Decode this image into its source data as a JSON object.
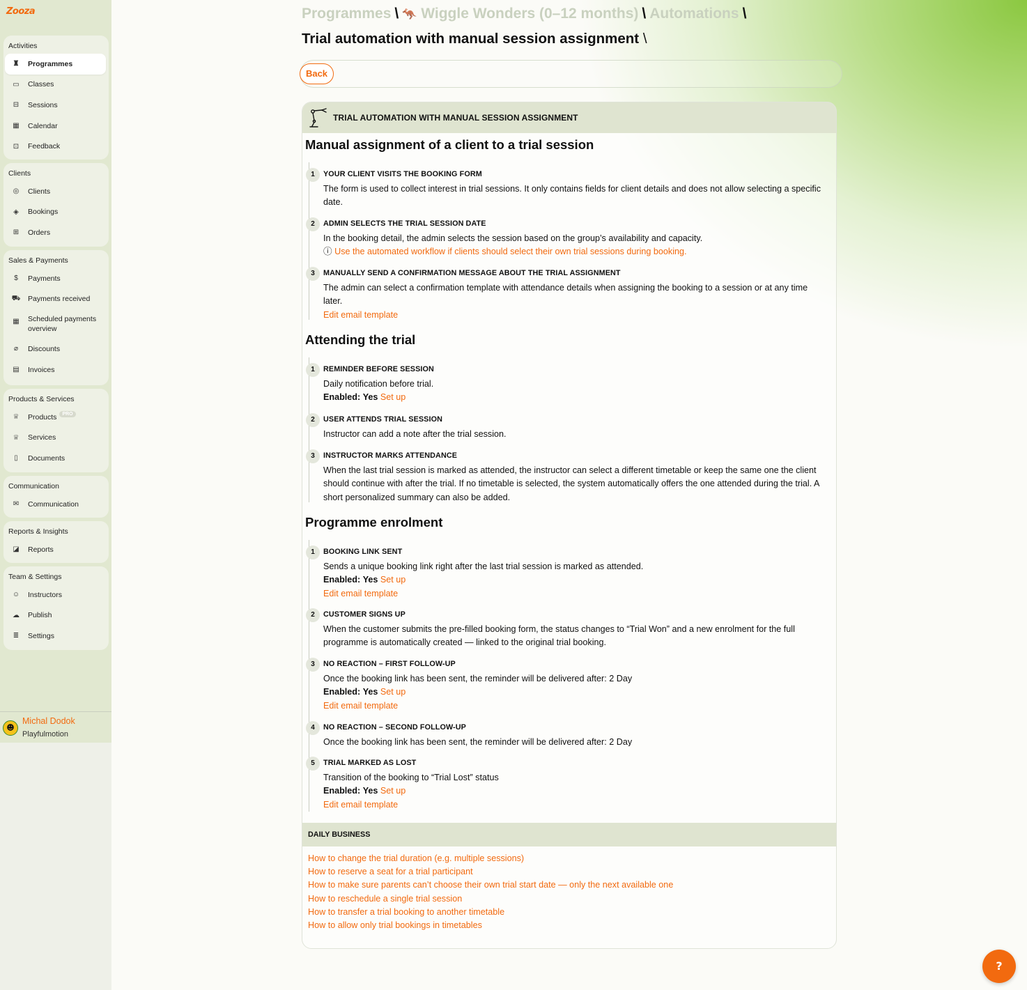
{
  "app": {
    "logo_text": "Zooza"
  },
  "sidebar": {
    "groups": [
      {
        "title": "Activities",
        "items": [
          {
            "label": "Programmes",
            "icon": "trophy-icon"
          },
          {
            "label": "Classes",
            "icon": "folder-icon"
          },
          {
            "label": "Sessions",
            "icon": "briefcase-icon"
          },
          {
            "label": "Calendar",
            "icon": "calendar-icon"
          },
          {
            "label": "Feedback",
            "icon": "inbox-icon"
          }
        ]
      },
      {
        "title": "Clients",
        "items": [
          {
            "label": "Clients",
            "icon": "users-icon"
          },
          {
            "label": "Bookings",
            "icon": "layers-icon"
          },
          {
            "label": "Orders",
            "icon": "gift-icon"
          }
        ]
      },
      {
        "title": "Sales & Payments",
        "items": [
          {
            "label": "Payments",
            "icon": "dollar-icon"
          },
          {
            "label": "Payments received",
            "icon": "cart-icon"
          },
          {
            "label": "Scheduled payments overview",
            "icon": "calendar-grid-icon"
          },
          {
            "label": "Discounts",
            "icon": "tag-icon"
          },
          {
            "label": "Invoices",
            "icon": "receipt-icon"
          }
        ]
      },
      {
        "title": "Products & Services",
        "items": [
          {
            "label": "Products",
            "icon": "crown-icon",
            "badge": "PRO"
          },
          {
            "label": "Services",
            "icon": "crown-icon"
          },
          {
            "label": "Documents",
            "icon": "document-icon"
          }
        ]
      },
      {
        "title": "Communication",
        "items": [
          {
            "label": "Communication",
            "icon": "mail-icon"
          }
        ]
      },
      {
        "title": "Reports & Insights",
        "items": [
          {
            "label": "Reports",
            "icon": "chart-icon"
          }
        ]
      },
      {
        "title": "Team & Settings",
        "items": [
          {
            "label": "Instructors",
            "icon": "user-icon"
          },
          {
            "label": "Publish",
            "icon": "cloud-upload-icon"
          },
          {
            "label": "Settings",
            "icon": "sliders-icon"
          }
        ]
      }
    ],
    "user": {
      "name": "Michal Dodok",
      "org": "Playfulmotion"
    }
  },
  "breadcrumb": {
    "items": [
      "Programmes",
      "Wiggle Wonders (0–12 months)",
      "Automations"
    ],
    "separator": "\\"
  },
  "page": {
    "title": "Trial automation with manual session assignment",
    "title_suffix": "\\",
    "back_label": "Back"
  },
  "card": {
    "header": "TRIAL AUTOMATION WITH MANUAL SESSION ASSIGNMENT",
    "sections": [
      {
        "title": "Manual assignment of a client to a trial session",
        "steps": [
          {
            "num": "1",
            "title": "YOUR CLIENT VISITS THE BOOKING FORM",
            "text": "The form is used to collect interest in trial sessions. It only contains fields for client details and does not allow selecting a specific date."
          },
          {
            "num": "2",
            "title": "ADMIN SELECTS THE TRIAL SESSION DATE",
            "text": "In the booking detail, the admin selects the session based on the group’s availability and capacity.",
            "info_link": "Use the automated workflow if clients should select their own trial sessions during booking."
          },
          {
            "num": "3",
            "title": "MANUALLY SEND A CONFIRMATION MESSAGE ABOUT THE TRIAL ASSIGNMENT",
            "text": "The admin can select a confirmation template with attendance details when assigning the booking to a session or at any time later.",
            "link": "Edit email template"
          }
        ]
      },
      {
        "title": "Attending the trial",
        "steps": [
          {
            "num": "1",
            "title": "REMINDER BEFORE SESSION",
            "text": "Daily notification before trial.",
            "enabled_label": "Enabled:",
            "enabled_value": "Yes",
            "setup_link": "Set up"
          },
          {
            "num": "2",
            "title": "USER ATTENDS TRIAL SESSION",
            "text": "Instructor can add a note after the trial session."
          },
          {
            "num": "3",
            "title": "INSTRUCTOR MARKS ATTENDANCE",
            "text": "When the last trial session is marked as attended, the instructor can select a different timetable or keep the same one the client should continue with after the trial. If no timetable is selected, the system automatically offers the one attended during the trial. A short personalized summary can also be added."
          }
        ]
      },
      {
        "title": "Programme enrolment",
        "steps": [
          {
            "num": "1",
            "title": "BOOKING LINK SENT",
            "text": "Sends a unique booking link right after the last trial session is marked as attended.",
            "enabled_label": "Enabled:",
            "enabled_value": "Yes",
            "setup_link": "Set up",
            "link": "Edit email template"
          },
          {
            "num": "2",
            "title": "CUSTOMER SIGNS UP",
            "text": "When the customer submits the pre-filled booking form, the status changes to “Trial Won” and a new enrolment for the full programme is automatically created — linked to the original trial booking."
          },
          {
            "num": "3",
            "title": "NO REACTION – FIRST FOLLOW-UP",
            "text": "Once the booking link has been sent, the reminder will be delivered after: 2 Day",
            "enabled_label": "Enabled:",
            "enabled_value": "Yes",
            "setup_link": "Set up",
            "link": "Edit email template"
          },
          {
            "num": "4",
            "title": "NO REACTION – SECOND FOLLOW-UP",
            "text": "Once the booking link has been sent, the reminder will be delivered after: 2 Day"
          },
          {
            "num": "5",
            "title": "TRIAL MARKED AS LOST",
            "text": "Transition of the booking to “Trial Lost” status",
            "enabled_label": "Enabled:",
            "enabled_value": "Yes",
            "setup_link": "Set up",
            "link": "Edit email template"
          }
        ]
      }
    ],
    "daily_business": {
      "title": "DAILY BUSINESS",
      "links": [
        "How to change the trial duration (e.g. multiple sessions)",
        "How to reserve a seat for a trial participant",
        "How to make sure parents can’t choose their own trial start date — only the next available one",
        "How to reschedule a single trial session",
        "How to transfer a trial booking to another timetable",
        "How to allow only trial bookings in timetables"
      ]
    }
  },
  "help_button": {
    "icon": "question-icon",
    "glyph": "?"
  },
  "colors": {
    "accent": "#f26a0f",
    "brand_green": "#8bc840"
  }
}
